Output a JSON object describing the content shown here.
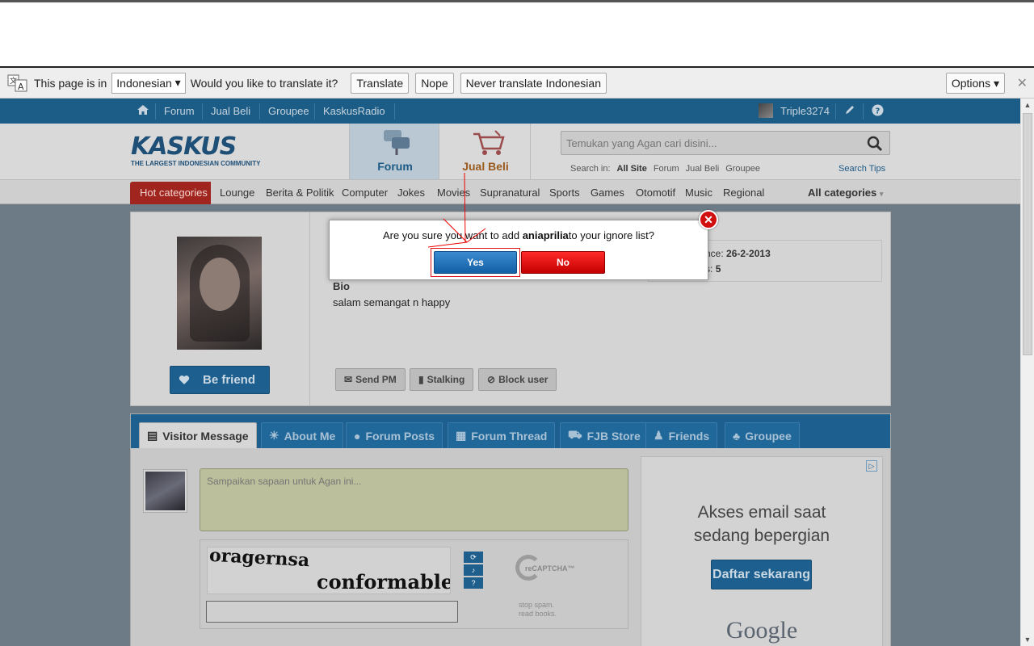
{
  "translate_bar": {
    "text_before": "This page is in",
    "language": "Indonesian",
    "text_after": "Would you like to translate it?",
    "translate_label": "Translate",
    "nope_label": "Nope",
    "never_label": "Never translate Indonesian",
    "options_label": "Options"
  },
  "navbar": {
    "items": [
      "Forum",
      "Jual Beli",
      "Groupee",
      "KaskusRadio"
    ],
    "username": "Triple3274"
  },
  "header": {
    "logo_text": "KASKUS",
    "logo_tagline": "THE LARGEST INDONESIAN COMMUNITY",
    "tab_forum": "Forum",
    "tab_jual_beli": "Jual Beli",
    "search_placeholder": "Temukan yang Agan cari disini...",
    "search_in_label": "Search in:",
    "search_in_options": [
      "All Site",
      "Forum",
      "Jual Beli",
      "Groupee"
    ],
    "search_tips": "Search Tips"
  },
  "categories": {
    "hot": "Hot categories",
    "items": [
      "Lounge",
      "Berita & Politik",
      "Computer",
      "Jokes",
      "Movies",
      "Supranatural",
      "Sports",
      "Games",
      "Otomotif",
      "Music",
      "Regional"
    ],
    "all": "All categories"
  },
  "profile": {
    "be_friend": "Be friend",
    "since_label": "nce:",
    "since_value": "26-2-2013",
    "count_label": "s:",
    "count_value": "5",
    "bio_label": "Bio",
    "bio_text": "salam semangat n happy",
    "send_pm": "Send PM",
    "stalking": "Stalking",
    "block_user": "Block user"
  },
  "profile_tabs": [
    "Visitor Message",
    "About Me",
    "Forum Posts",
    "Forum Thread",
    "FJB Store",
    "Friends",
    "Groupee"
  ],
  "visitor": {
    "message_placeholder": "Sampaikan sapaan untuk Agan ini...",
    "captcha_word1": "oragernsa",
    "captcha_word2": "conformable",
    "recaptcha_label": "reCAPTCHA™",
    "recaptcha_slogan1": "stop spam.",
    "recaptcha_slogan2": "read books."
  },
  "ad": {
    "headline1": "Akses email saat",
    "headline2": "sedang bepergian",
    "cta": "Daftar sekarang",
    "brand": "Google"
  },
  "dialog": {
    "question_prefix": "Are you sure you want to add",
    "username": "aniaprilia",
    "question_suffix": "to your ignore list?",
    "yes_label": "Yes",
    "no_label": "No"
  },
  "colors": {
    "primary_blue": "#1d5f8e",
    "hot_red": "#a0251e",
    "dialog_yes": "#1b6bb3",
    "dialog_no": "#e00000"
  }
}
